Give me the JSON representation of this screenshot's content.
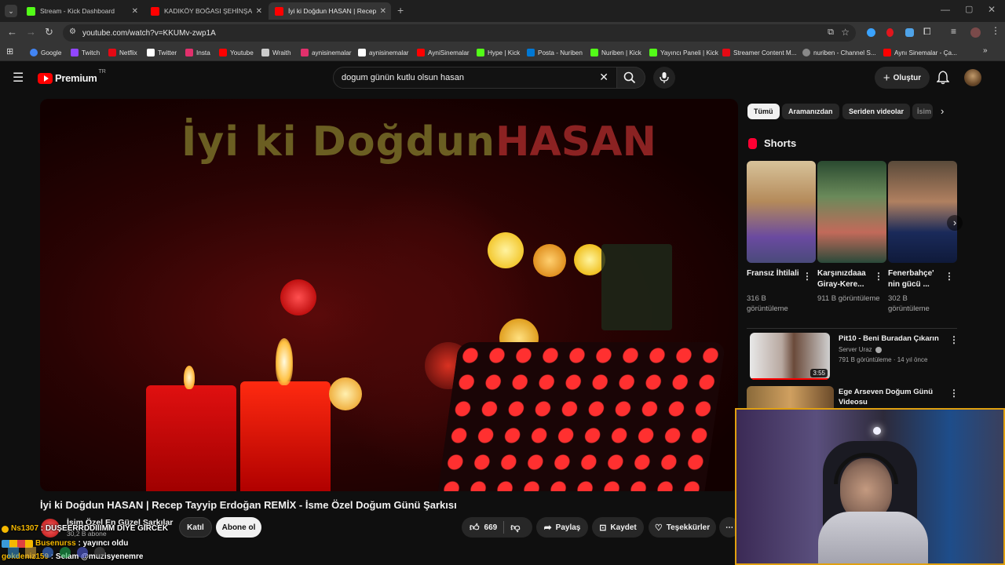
{
  "browser": {
    "tabs": [
      {
        "title": "Stream - Kick Dashboard",
        "favicon_color": "#53fc18"
      },
      {
        "title": "KADIKÖY BOĞASI ŞEHİNŞAH VE",
        "favicon_color": "#ff0000"
      },
      {
        "title": "İyi ki Doğdun HASAN | Recep T",
        "favicon_color": "#ff0000"
      }
    ],
    "url": "youtube.com/watch?v=KKUMv-zwp1A",
    "bookmarks": [
      {
        "label": "Google",
        "color": "#4285f4"
      },
      {
        "label": "Twitch",
        "color": "#9146ff"
      },
      {
        "label": "Netflix",
        "color": "#e50914"
      },
      {
        "label": "Twitter",
        "color": "#ffffff"
      },
      {
        "label": "Insta",
        "color": "#e1306c"
      },
      {
        "label": "Youtube",
        "color": "#ff0000"
      },
      {
        "label": "Wraith",
        "color": "#cccccc"
      },
      {
        "label": "aynisinemalar",
        "color": "#e1306c"
      },
      {
        "label": "aynisinemalar",
        "color": "#ffffff"
      },
      {
        "label": "AyniSinemalar",
        "color": "#ff0000"
      },
      {
        "label": "Hype | Kick",
        "color": "#53fc18"
      },
      {
        "label": "Posta - Nuriben",
        "color": "#0078d4"
      },
      {
        "label": "Nuriben | Kick",
        "color": "#53fc18"
      },
      {
        "label": "Yayıncı Paneli | Kick",
        "color": "#53fc18"
      },
      {
        "label": "Streamer Content M...",
        "color": "#e50914"
      },
      {
        "label": "nuriben - Channel S...",
        "color": "#888888"
      },
      {
        "label": "Aynı Sinemalar - Ça...",
        "color": "#ff0000"
      }
    ]
  },
  "youtube": {
    "logo_text": "Premium",
    "region": "TR",
    "search_value": "dogum günün kutlu olsun hasan",
    "create_label": "Oluştur",
    "video": {
      "overlay_text_1": "İyi ki Doğdun",
      "overlay_text_2": "HASAN",
      "title": "İyi ki Doğdun HASAN | Recep Tayyip Erdoğan REMİX - İsme Özel Doğum Günü Şarkısı",
      "channel_name": "İsim Özel En Güzel Şarkılar",
      "subscribers": "30,2 B abone",
      "join_label": "Katıl",
      "subscribe_label": "Abone ol",
      "likes": "669",
      "share_label": "Paylaş",
      "save_label": "Kaydet",
      "thanks_label": "Teşekkürler"
    },
    "chips": [
      "Tümü",
      "Aramanızdan",
      "Seriden videolar",
      "İsim"
    ],
    "shorts_heading": "Shorts",
    "shorts": [
      {
        "title": "Fransız İhtilali",
        "views": "316 B görüntüleme"
      },
      {
        "title": "Karşınızdaaa Giray-Kere...",
        "views": "911 B görüntüleme"
      },
      {
        "title": "Fenerbahçe' nin gücü ...",
        "views": "302 B görüntüleme"
      }
    ],
    "related": [
      {
        "title": "Pit10 - Beni Buradan Çıkarın",
        "channel": "Server Uraz",
        "meta": "791 B görüntüleme · 14 yıl önce",
        "duration": "3:55"
      },
      {
        "title": "Ege Arseven Doğum Günü Videosu"
      }
    ]
  },
  "chat": [
    {
      "user": "Ns1307",
      "message": "DUŞEERRDDIIIMM DİYE GİRCEK",
      "user_color": "#f5b800"
    },
    {
      "user": "Busenurss",
      "message": "yayıncı oldu",
      "user_color": "#f5b800"
    },
    {
      "user": "gokdeniz159",
      "message": "Selam @muzisyenemre",
      "user_color": "#f5b800"
    }
  ]
}
